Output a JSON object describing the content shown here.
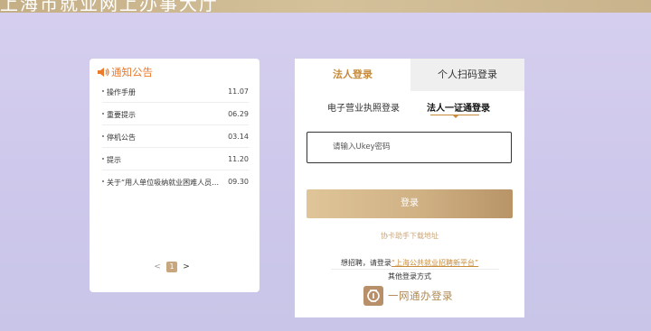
{
  "header": {
    "title": "上海市就业网上办事大厅"
  },
  "notice": {
    "title": "通知公告",
    "items": [
      {
        "text": "操作手册",
        "date": "11.07"
      },
      {
        "text": "重要提示",
        "date": "06.29"
      },
      {
        "text": "停机公告",
        "date": "03.14"
      },
      {
        "text": "提示",
        "date": "11.20"
      },
      {
        "text": "关于“用人单位吸纳就业困难人员岗位补贴”",
        "date": "09.30"
      }
    ],
    "pagination": {
      "prev": "<",
      "current": "1",
      "next": ">"
    }
  },
  "login": {
    "tabs": {
      "legal_person": "法人登录",
      "personal_scan": "个人扫码登录"
    },
    "sub_tabs": {
      "license": "电子营业执照登录",
      "one_cert": "法人一证通登录"
    },
    "ukey_placeholder": "请输入Ukey密码",
    "login_button": "登录",
    "download_link": "协卡助手下载地址",
    "recruit_prefix": "想招聘，请登录",
    "recruit_link": "“上海公共就业招聘新平台”",
    "other_methods": "其他登录方式",
    "gov_login": "一网通办登录"
  },
  "colors": {
    "accent": "#c78b3a",
    "notice_title": "#ec7a2c",
    "button_gold": "#cfb184"
  }
}
